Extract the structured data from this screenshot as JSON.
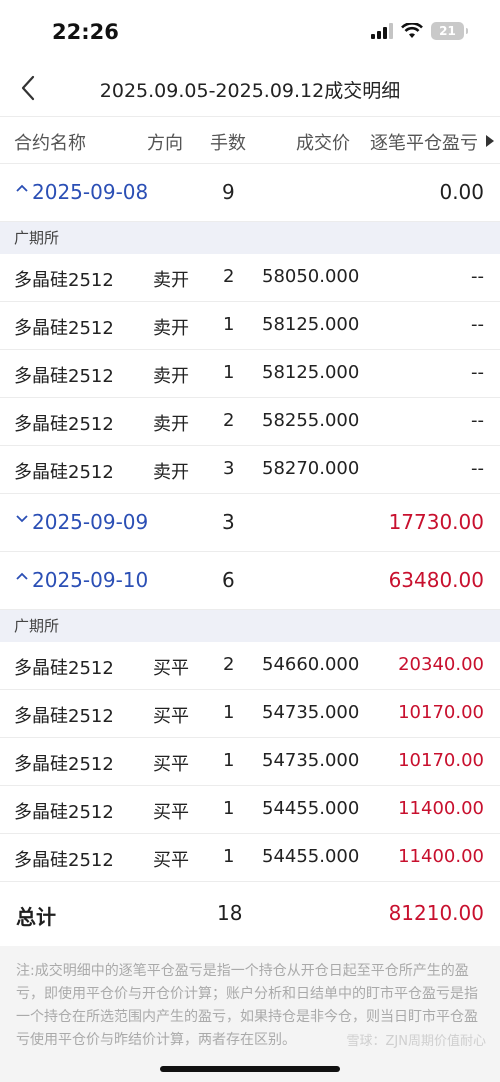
{
  "status_bar": {
    "time": "22:26",
    "battery": "21"
  },
  "nav": {
    "title": "2025.09.05-2025.09.12成交明细"
  },
  "columns": {
    "contract": "合约名称",
    "direction": "方向",
    "quantity": "手数",
    "price": "成交价",
    "pnl": "逐笔平仓盈亏"
  },
  "groups": [
    {
      "date": "2025-09-08",
      "qty": "9",
      "pnl": "0.00",
      "expanded": true,
      "exchange": "广期所",
      "trades": [
        {
          "name": "多晶硅2512",
          "dir": "卖开",
          "qty": "2",
          "price": "58050.000",
          "pnl": "--"
        },
        {
          "name": "多晶硅2512",
          "dir": "卖开",
          "qty": "1",
          "price": "58125.000",
          "pnl": "--"
        },
        {
          "name": "多晶硅2512",
          "dir": "卖开",
          "qty": "1",
          "price": "58125.000",
          "pnl": "--"
        },
        {
          "name": "多晶硅2512",
          "dir": "卖开",
          "qty": "2",
          "price": "58255.000",
          "pnl": "--"
        },
        {
          "name": "多晶硅2512",
          "dir": "卖开",
          "qty": "3",
          "price": "58270.000",
          "pnl": "--"
        }
      ]
    },
    {
      "date": "2025-09-09",
      "qty": "3",
      "pnl": "17730.00",
      "expanded": false
    },
    {
      "date": "2025-09-10",
      "qty": "6",
      "pnl": "63480.00",
      "expanded": true,
      "exchange": "广期所",
      "trades": [
        {
          "name": "多晶硅2512",
          "dir": "买平",
          "qty": "2",
          "price": "54660.000",
          "pnl": "20340.00"
        },
        {
          "name": "多晶硅2512",
          "dir": "买平",
          "qty": "1",
          "price": "54735.000",
          "pnl": "10170.00"
        },
        {
          "name": "多晶硅2512",
          "dir": "买平",
          "qty": "1",
          "price": "54735.000",
          "pnl": "10170.00"
        },
        {
          "name": "多晶硅2512",
          "dir": "买平",
          "qty": "1",
          "price": "54455.000",
          "pnl": "11400.00"
        },
        {
          "name": "多晶硅2512",
          "dir": "买平",
          "qty": "1",
          "price": "54455.000",
          "pnl": "11400.00"
        }
      ]
    }
  ],
  "total": {
    "label": "总计",
    "qty": "18",
    "pnl": "81210.00"
  },
  "note": "注:成交明细中的逐笔平仓盈亏是指一个持仓从开仓日起至平仓所产生的盈亏，即使用平仓价与开仓价计算；账户分析和日结单中的盯市平仓盈亏是指一个持仓在所选范围内产生的盈亏，如果持仓是非今仓，则当日盯市平仓盈亏使用平仓价与昨结价计算，两者存在区别。",
  "watermark": "雪球：ZJN周期价值耐心",
  "colors": {
    "date_blue": "#2b4fb5",
    "profit_red": "#c8102e",
    "exchange_bg": "#eef0f7"
  }
}
